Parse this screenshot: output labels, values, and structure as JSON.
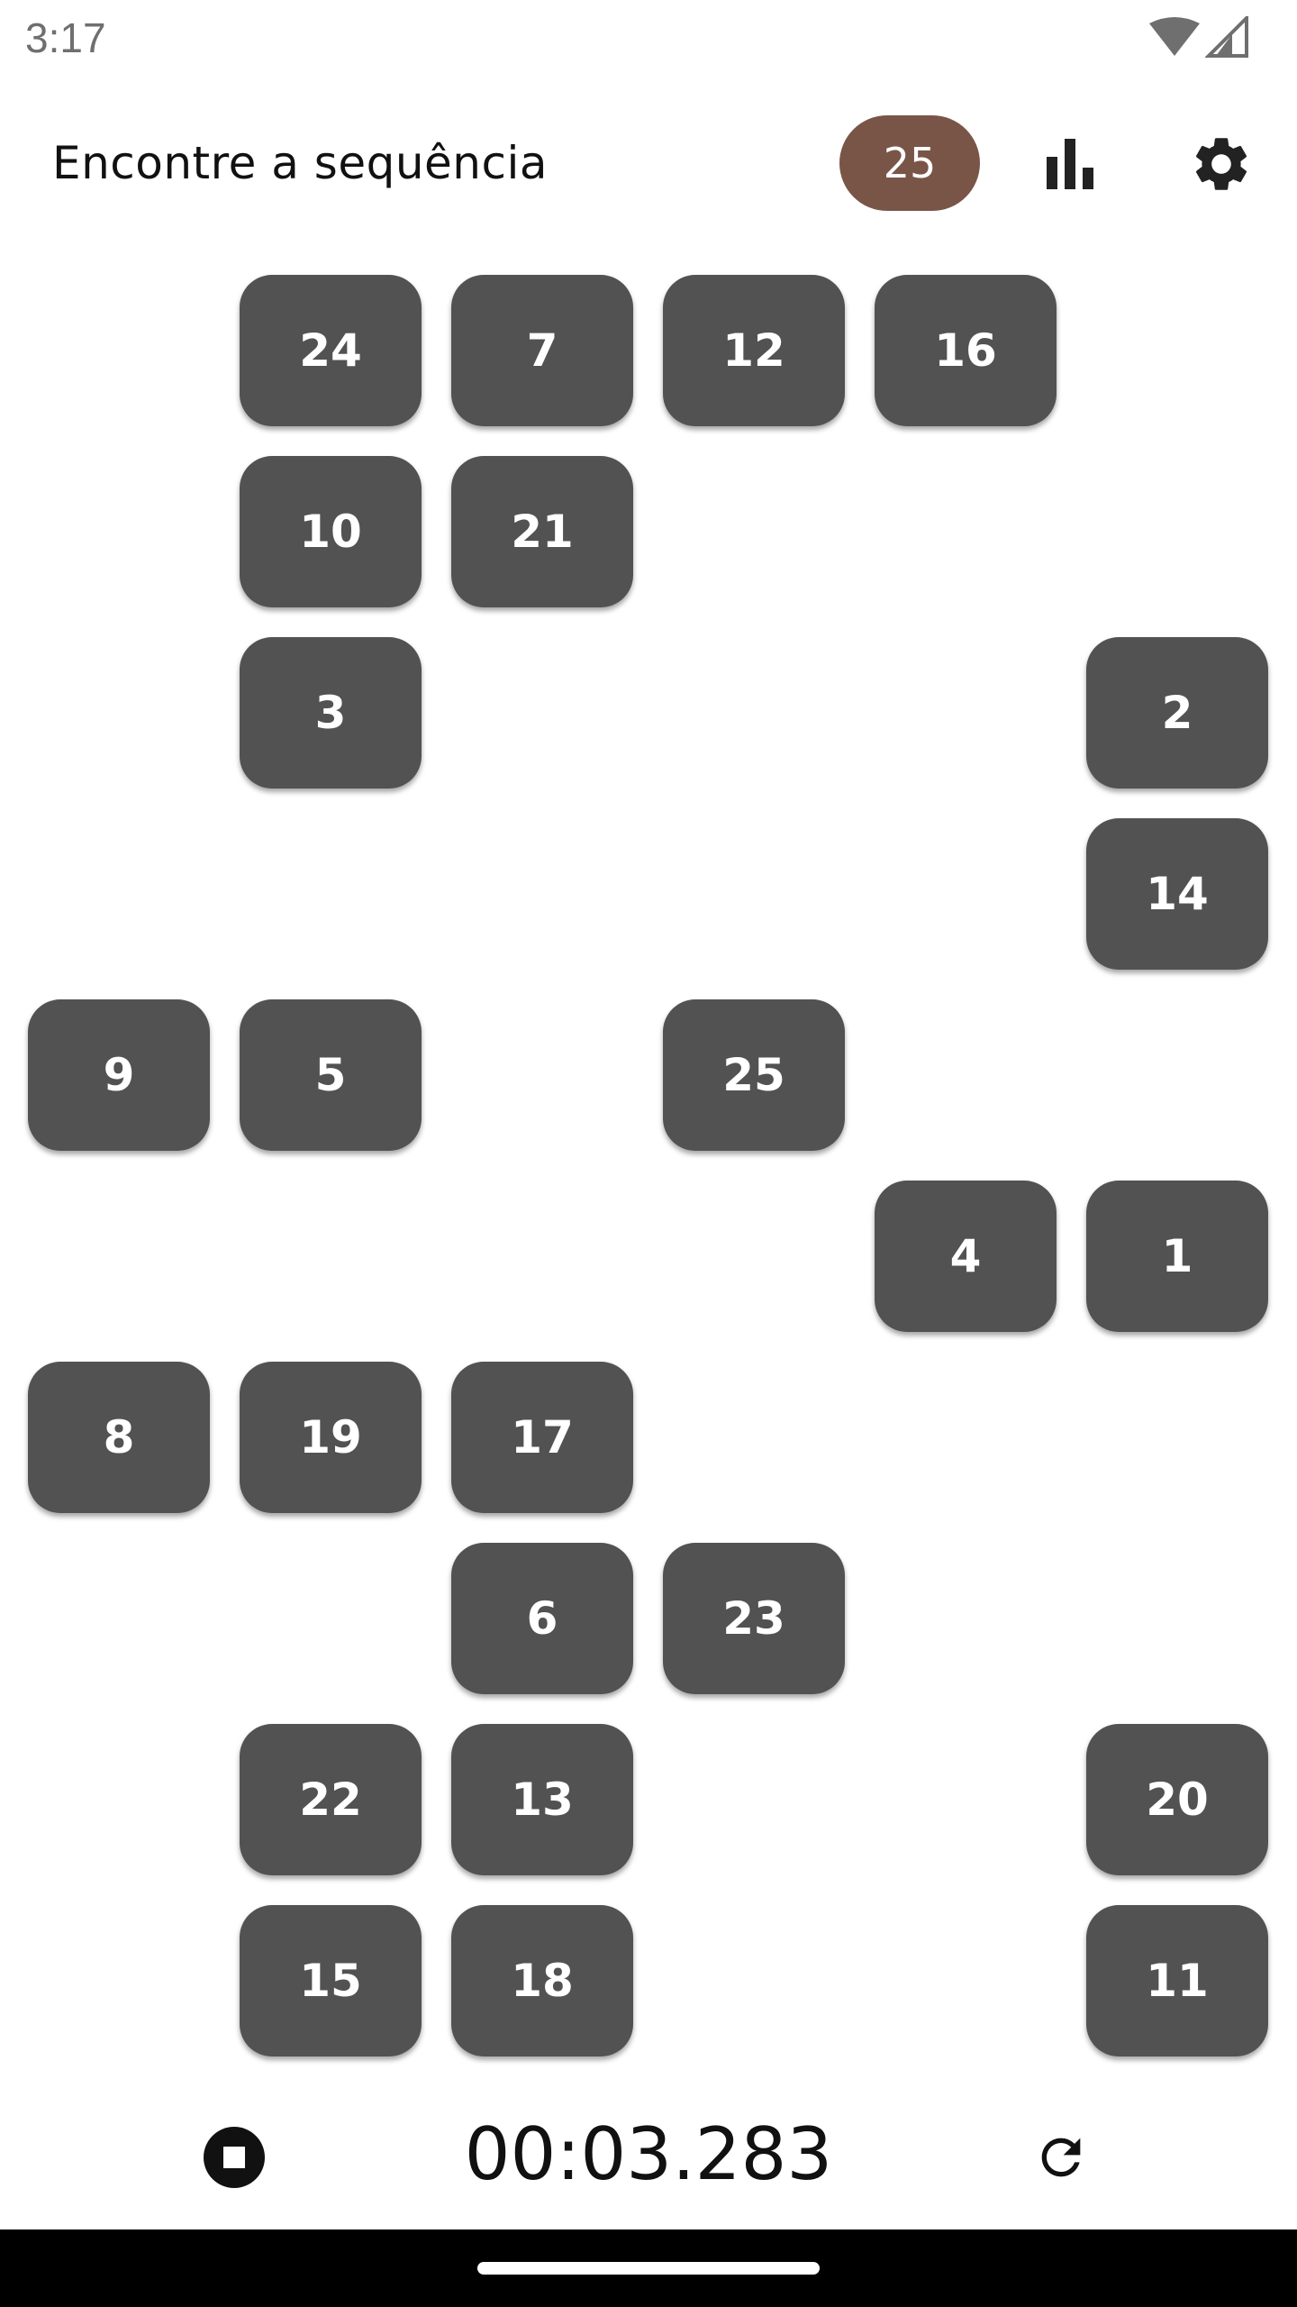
{
  "status_bar": {
    "time": "3:17",
    "icons": [
      "wifi-icon",
      "cell-signal-icon"
    ]
  },
  "app_bar": {
    "title": "Encontre a sequência",
    "count": "25",
    "stats_icon": "bar-chart-icon",
    "settings_icon": "gear-icon"
  },
  "tiles": [
    "24",
    "7",
    "12",
    "16",
    "10",
    "21",
    "3",
    "2",
    "14",
    "9",
    "5",
    "25",
    "4",
    "1",
    "8",
    "19",
    "17",
    "6",
    "23",
    "22",
    "13",
    "20",
    "15",
    "18",
    "11"
  ],
  "bottom_bar": {
    "stop_icon": "stop-icon",
    "timer": "00:03.283",
    "refresh_icon": "refresh-icon"
  },
  "colors": {
    "tile": "#525252",
    "badge": "#795548",
    "text_dark": "#111111"
  }
}
